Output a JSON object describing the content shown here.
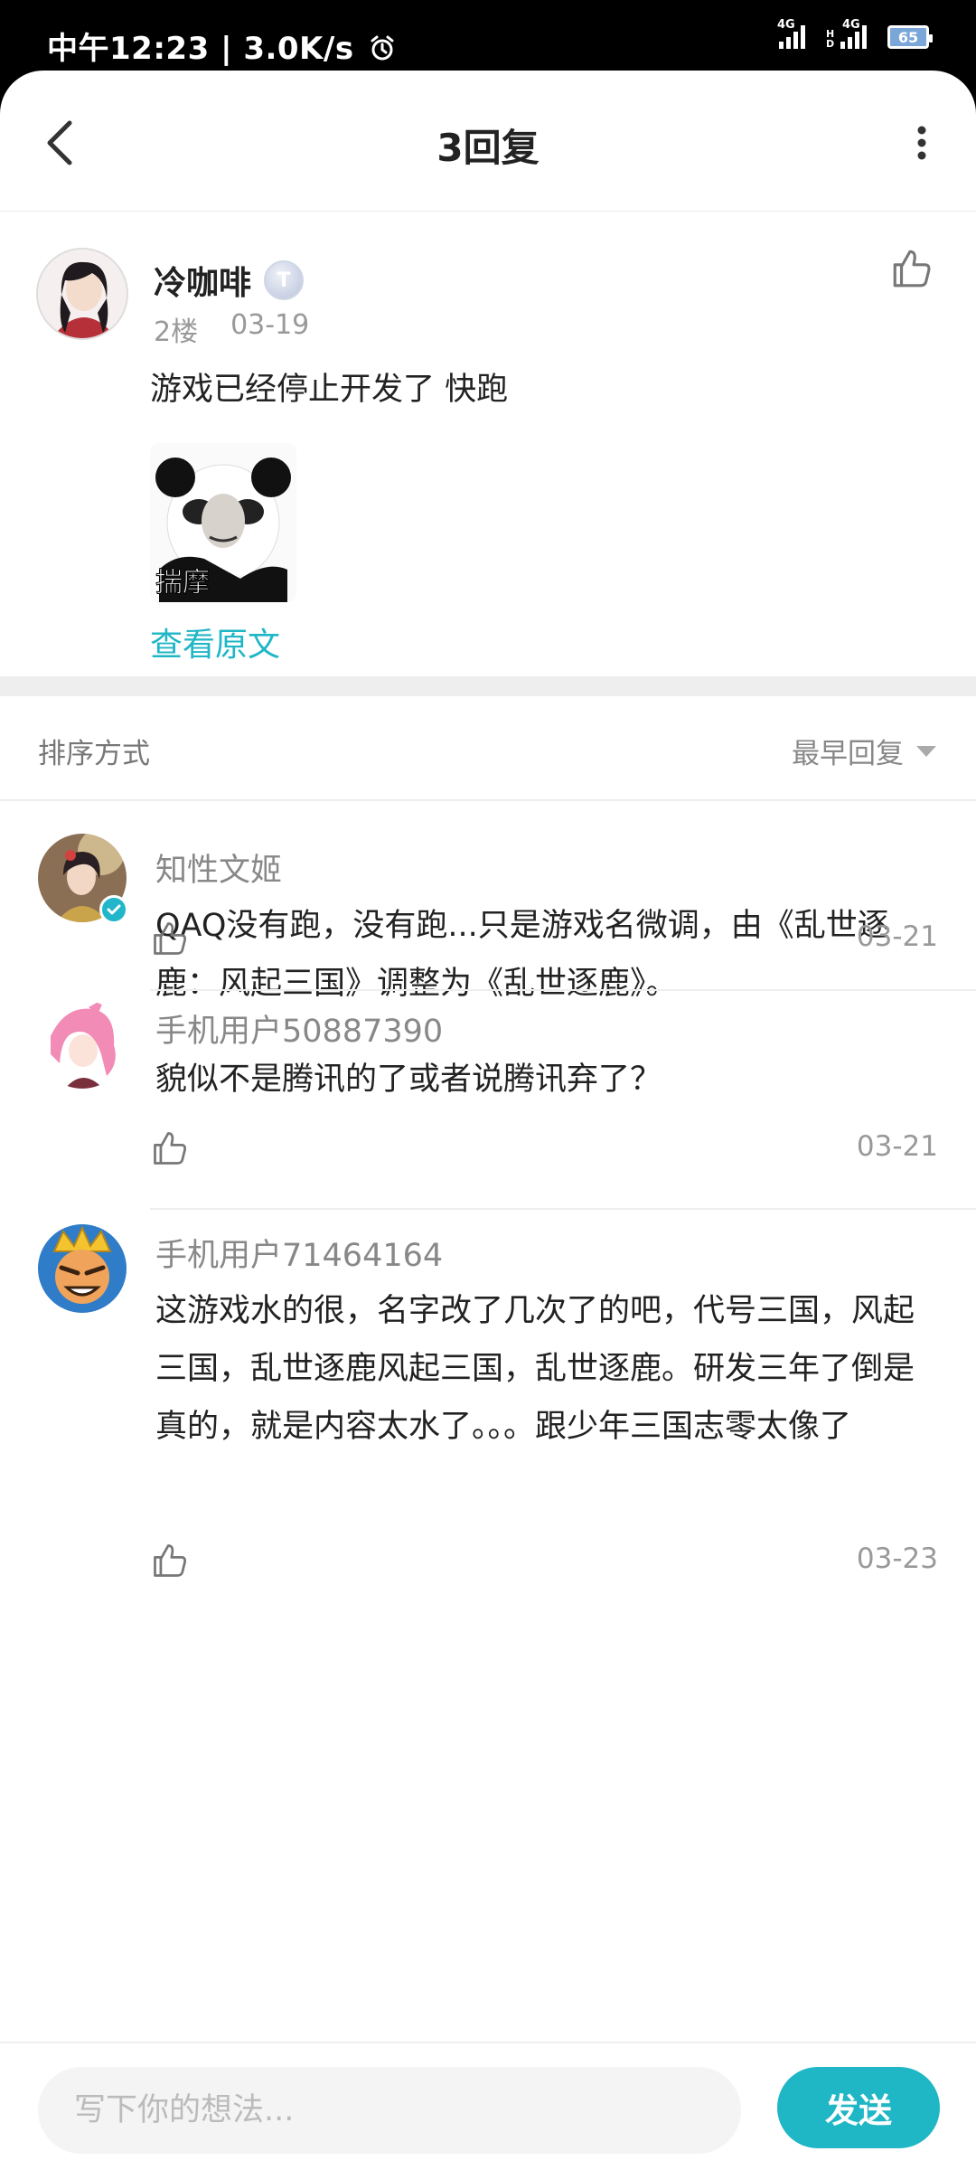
{
  "status_bar": {
    "time": "中午12:23",
    "speed": "3.0K/s",
    "network_1": "4G",
    "network_2": "4G",
    "hd": "HD",
    "battery": "65"
  },
  "header": {
    "title": "3回复",
    "back_icon": "chevron-left-icon",
    "more_icon": "more-vertical-icon"
  },
  "post": {
    "author": "冷咖啡",
    "badge": "T",
    "floor": "2楼",
    "date": "03-19",
    "text": "游戏已经停止开发了 快跑",
    "sticker_text": "揣摩",
    "view_original": "查看原文"
  },
  "sort": {
    "label": "排序方式",
    "selected": "最早回复"
  },
  "replies": [
    {
      "name": "知性文姬",
      "text": "QAQ没有跑，没有跑...只是游戏名微调，由《乱世逐鹿：风起三国》调整为《乱世逐鹿》。",
      "date": "03-21"
    },
    {
      "name": "手机用户50887390",
      "text": "貌似不是腾讯的了或者说腾讯弃了？",
      "date": "03-21"
    },
    {
      "name": "手机用户71464164",
      "text": "这游戏水的很，名字改了几次了的吧，代号三国，风起三国，乱世逐鹿风起三国，乱世逐鹿。研发三年了倒是真的，就是内容太水了。。。跟少年三国志零太像了",
      "date": "03-23"
    }
  ],
  "composer": {
    "placeholder": "写下你的想法...",
    "send_label": "发送"
  },
  "colors": {
    "accent": "#1fb6c6",
    "divider": "#eeeeee"
  }
}
